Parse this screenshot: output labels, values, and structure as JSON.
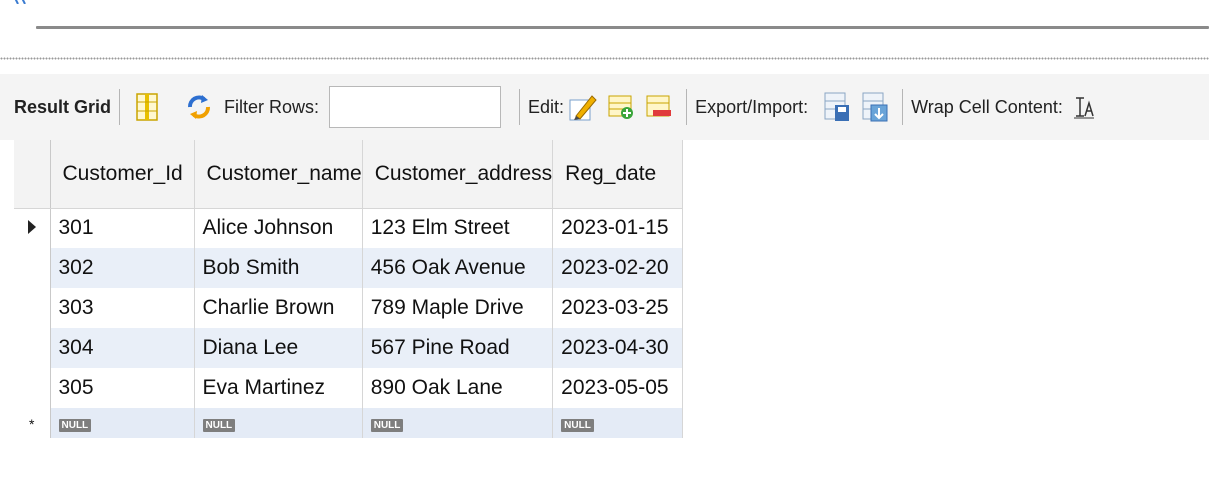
{
  "toolbar": {
    "result_grid_label": "Result Grid",
    "filter_rows_label": "Filter Rows:",
    "filter_rows_value": "",
    "edit_label": "Edit:",
    "export_import_label": "Export/Import:",
    "wrap_cell_label": "Wrap Cell Content:",
    "icons": [
      "form-editor-icon",
      "filter-icon",
      "edit-pencil-icon",
      "add-row-icon",
      "delete-row-icon",
      "export-icon",
      "import-icon",
      "wrap-text-icon"
    ]
  },
  "grid": {
    "columns": [
      "Customer_Id",
      "Customer_name",
      "Customer_address",
      "Reg_date"
    ],
    "rows": [
      [
        "301",
        "Alice Johnson",
        "123 Elm Street",
        "2023-01-15"
      ],
      [
        "302",
        "Bob Smith",
        "456 Oak Avenue",
        "2023-02-20"
      ],
      [
        "303",
        "Charlie Brown",
        "789 Maple Drive",
        "2023-03-25"
      ],
      [
        "304",
        "Diana Lee",
        "567 Pine Road",
        "2023-04-30"
      ],
      [
        "305",
        "Eva Martinez",
        "890 Oak Lane",
        "2023-05-05"
      ]
    ],
    "null_label": "NULL",
    "null_row": [
      "NULL",
      "NULL",
      "NULL",
      "NULL"
    ],
    "new_row_marker": "*"
  },
  "colors": {
    "toolbar_bg": "#f4f4f4",
    "alt_row_bg": "#e9eff8",
    "null_badge_bg": "#7e7e7e"
  }
}
